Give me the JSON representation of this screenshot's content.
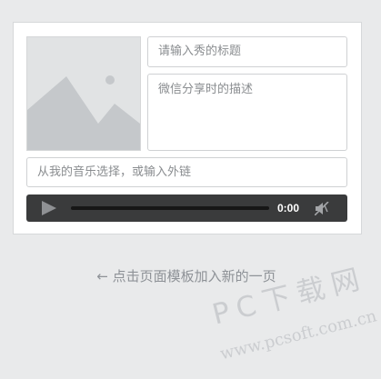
{
  "form": {
    "title_placeholder": "请输入秀的标题",
    "description_placeholder": "微信分享时的描述",
    "music_placeholder": "从我的音乐选择，或输入外链"
  },
  "player": {
    "time": "0:00",
    "progress": 0
  },
  "hint": "← 点击页面模板加入新的一页",
  "watermark": {
    "text": "PC下载网",
    "url": "www.pcsoft.com.cn"
  },
  "colors": {
    "background": "#e9eaeb",
    "player_bg": "#3a3b3c",
    "hint_text": "#8e9297"
  },
  "icons": {
    "image_placeholder": "image-icon",
    "play": "play-icon",
    "mute": "mute-icon"
  }
}
